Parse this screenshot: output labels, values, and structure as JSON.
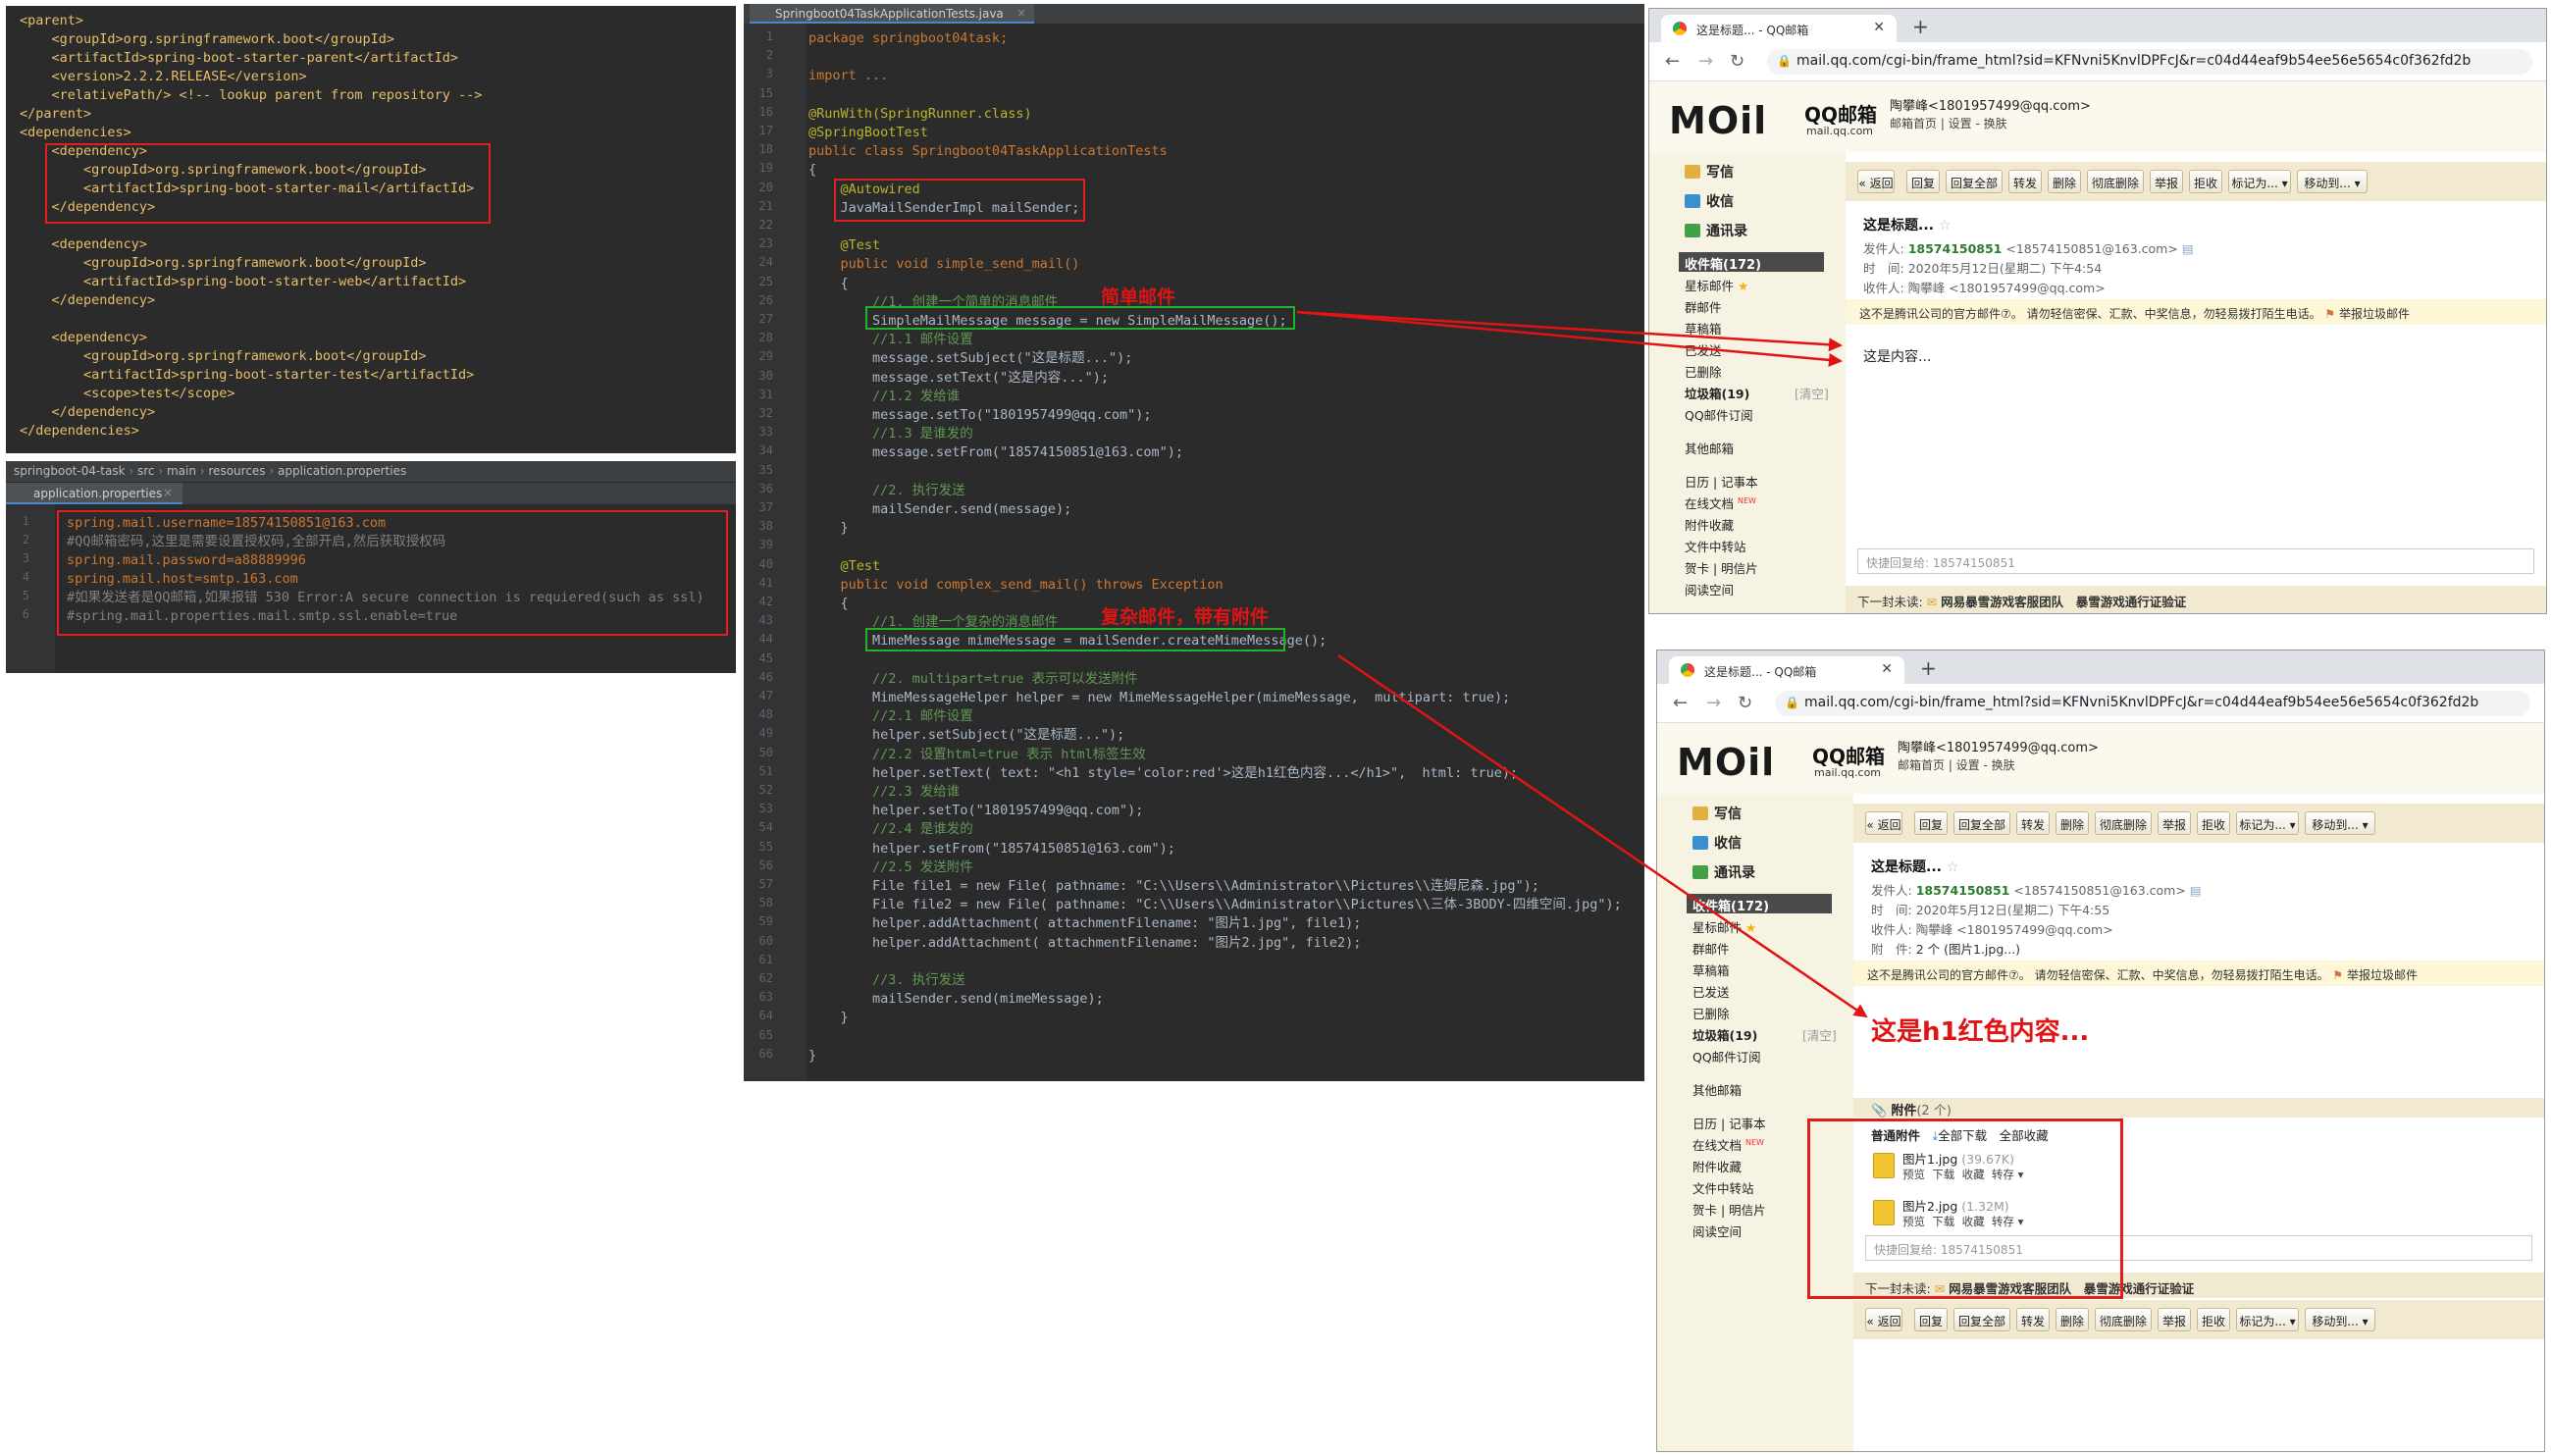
{
  "pom": {
    "lines": [
      "<parent>",
      "    <groupId>org.springframework.boot</groupId>",
      "    <artifactId>spring-boot-starter-parent</artifactId>",
      "    <version>2.2.2.RELEASE</version>",
      "    <relativePath/> <!-- lookup parent from repository -->",
      "</parent>",
      "<dependencies>",
      "    <dependency>",
      "        <groupId>org.springframework.boot</groupId>",
      "        <artifactId>spring-boot-starter-mail</artifactId>",
      "    </dependency>",
      "",
      "    <dependency>",
      "        <groupId>org.springframework.boot</groupId>",
      "        <artifactId>spring-boot-starter-web</artifactId>",
      "    </dependency>",
      "",
      "    <dependency>",
      "        <groupId>org.springframework.boot</groupId>",
      "        <artifactId>spring-boot-starter-test</artifactId>",
      "        <scope>test</scope>",
      "    </dependency>",
      "</dependencies>"
    ]
  },
  "props": {
    "breadcrumb": [
      "springboot-04-task",
      "src",
      "main",
      "resources",
      "application.properties"
    ],
    "tab": "application.properties",
    "line_numbers": [
      "1",
      "2",
      "3",
      "4",
      "5",
      "6"
    ],
    "lines": [
      "spring.mail.username=18574150851@163.com",
      "#QQ邮箱密码,这里是需要设置授权码,全部开启,然后获取授权码",
      "spring.mail.password=a88889996",
      "spring.mail.host=smtp.163.com",
      "#如果发送者是QQ邮箱,如果报错 530 Error:A secure connection is requiered(such as ssl)",
      "#spring.mail.properties.mail.smtp.ssl.enable=true"
    ]
  },
  "editor": {
    "tab": "Springboot04TaskApplicationTests.java",
    "line_numbers": [
      "1",
      "2",
      "3",
      "15",
      "16",
      "17",
      "18",
      "19",
      "20",
      "21",
      "22",
      "23",
      "24",
      "25",
      "26",
      "27",
      "28",
      "29",
      "30",
      "31",
      "32",
      "33",
      "34",
      "35",
      "36",
      "37",
      "38",
      "39",
      "40",
      "41",
      "42",
      "43",
      "44",
      "45",
      "46",
      "47",
      "48",
      "49",
      "50",
      "51",
      "52",
      "53",
      "54",
      "55",
      "56",
      "57",
      "58",
      "59",
      "60",
      "61",
      "62",
      "63",
      "64",
      "65",
      "66"
    ],
    "lines": [
      "package springboot04task;",
      "",
      "import ...",
      "",
      "@RunWith(SpringRunner.class)",
      "@SpringBootTest",
      "public class Springboot04TaskApplicationTests",
      "{",
      "    @Autowired",
      "    JavaMailSenderImpl mailSender;",
      "",
      "    @Test",
      "    public void simple_send_mail()",
      "    {",
      "        //1. 创建一个简单的消息邮件",
      "        SimpleMailMessage message = new SimpleMailMessage();",
      "        //1.1 邮件设置",
      "        message.setSubject(\"这是标题...\");",
      "        message.setText(\"这是内容...\");",
      "        //1.2 发给谁",
      "        message.setTo(\"1801957499@qq.com\");",
      "        //1.3 是谁发的",
      "        message.setFrom(\"18574150851@163.com\");",
      "",
      "        //2. 执行发送",
      "        mailSender.send(message);",
      "    }",
      "",
      "    @Test",
      "    public void complex_send_mail() throws Exception",
      "    {",
      "        //1. 创建一个复杂的消息邮件",
      "        MimeMessage mimeMessage = mailSender.createMimeMessage();",
      "",
      "        //2. multipart=true 表示可以发送附件",
      "        MimeMessageHelper helper = new MimeMessageHelper(mimeMessage,  multipart: true);",
      "        //2.1 邮件设置",
      "        helper.setSubject(\"这是标题...\");",
      "        //2.2 设置html=true 表示 html标签生效",
      "        helper.setText( text: \"<h1 style='color:red'>这是h1红色内容...</h1>\",  html: true);",
      "        //2.3 发给谁",
      "        helper.setTo(\"1801957499@qq.com\");",
      "        //2.4 是谁发的",
      "        helper.setFrom(\"18574150851@163.com\");",
      "        //2.5 发送附件",
      "        File file1 = new File( pathname: \"C:\\\\Users\\\\Administrator\\\\Pictures\\\\连姆尼森.jpg\");",
      "        File file2 = new File( pathname: \"C:\\\\Users\\\\Administrator\\\\Pictures\\\\三体-3BODY-四维空间.jpg\");",
      "        helper.addAttachment( attachmentFilename: \"图片1.jpg\", file1);",
      "        helper.addAttachment( attachmentFilename: \"图片2.jpg\", file2);",
      "",
      "        //3. 执行发送",
      "        mailSender.send(mimeMessage);",
      "    }",
      "",
      "}"
    ]
  },
  "annotations": {
    "simple": "简单邮件",
    "complex": "复杂邮件，带有附件"
  },
  "browser1": {
    "tab_title": "这是标题... - QQ邮箱",
    "url": "mail.qq.com/cgi-bin/frame_html?sid=KFNvni5KnvlDPFcJ&r=c04d44eaf9b54ee56e5654c0f362fd2b",
    "logo": "MOil",
    "logo_cn": "QQ邮箱",
    "logo_sub": "mail.qq.com",
    "user_email": "陶攀峰<1801957499@qq.com>",
    "user_links": "邮箱首页 | 设置 - 换肤",
    "side": {
      "compose": "写信",
      "inbox": "收信",
      "contacts": "通讯录",
      "inbox_count": "收件箱(172)",
      "starred": "星标邮件",
      "group": "群邮件",
      "drafts": "草稿箱",
      "sent": "已发送",
      "deleted": "已删除",
      "spam": "垃圾箱(19)",
      "clear": "[清空]",
      "subscribe": "QQ邮件订阅",
      "other": "其他邮箱",
      "calendar": "日历 | 记事本",
      "docs": "在线文档",
      "new_badge": "NEW",
      "attach_fav": "附件收藏",
      "transfer": "文件中转站",
      "cards": "贺卡 | 明信片",
      "reading": "阅读空间"
    },
    "toolbar": [
      "« 返回",
      "回复",
      "回复全部",
      "转发",
      "删除",
      "彻底删除",
      "举报",
      "拒收",
      "标记为... ▾",
      "移动到... ▾"
    ],
    "subject": "这是标题...",
    "from_label": "发件人:",
    "from_name": "18574150851",
    "from_addr": "<18574150851@163.com>",
    "time_label": "时　间:",
    "time": "2020年5月12日(星期二) 下午4:54",
    "to_label": "收件人:",
    "to": "陶攀峰 <1801957499@qq.com>",
    "warning": "这不是腾讯公司的官方邮件⑦。  请勿轻信密保、汇款、中奖信息，勿轻易拨打陌生电话。",
    "report": "举报垃圾邮件",
    "body": "这是内容...",
    "quick_reply": "快捷回复给: 18574150851",
    "next_label": "下一封未读:",
    "next_1": "网易暴雪游戏客服团队",
    "next_2": "暴雪游戏通行证验证"
  },
  "browser2": {
    "tab_title": "这是标题... - QQ邮箱",
    "url": "mail.qq.com/cgi-bin/frame_html?sid=KFNvni5KnvlDPFcJ&r=c04d44eaf9b54ee56e5654c0f362fd2b",
    "logo": "MOil",
    "logo_cn": "QQ邮箱",
    "logo_sub": "mail.qq.com",
    "user_email": "陶攀峰<1801957499@qq.com>",
    "user_links": "邮箱首页 | 设置 - 换肤",
    "side": {
      "compose": "写信",
      "inbox": "收信",
      "contacts": "通讯录",
      "inbox_count": "收件箱(172)",
      "starred": "星标邮件",
      "group": "群邮件",
      "drafts": "草稿箱",
      "sent": "已发送",
      "deleted": "已删除",
      "spam": "垃圾箱(19)",
      "clear": "[清空]",
      "subscribe": "QQ邮件订阅",
      "other": "其他邮箱",
      "calendar": "日历 | 记事本",
      "docs": "在线文档",
      "new_badge": "NEW",
      "attach_fav": "附件收藏",
      "transfer": "文件中转站",
      "cards": "贺卡 | 明信片",
      "reading": "阅读空间"
    },
    "toolbar": [
      "« 返回",
      "回复",
      "回复全部",
      "转发",
      "删除",
      "彻底删除",
      "举报",
      "拒收",
      "标记为... ▾",
      "移动到... ▾"
    ],
    "subject": "这是标题...",
    "from_label": "发件人:",
    "from_name": "18574150851",
    "from_addr": "<18574150851@163.com>",
    "time_label": "时　间:",
    "time": "2020年5月12日(星期二) 下午4:55",
    "to_label": "收件人:",
    "to": "陶攀峰 <1801957499@qq.com>",
    "attach_label": "附　件:",
    "attach_summary": "2 个 (图片1.jpg...)",
    "warning": "这不是腾讯公司的官方邮件⑦。  请勿轻信密保、汇款、中奖信息，勿轻易拨打陌生电话。",
    "report": "举报垃圾邮件",
    "body_h1": "这是h1红色内容...",
    "attach_title": "附件",
    "attach_count": "(2 个)",
    "attach_normal": "普通附件",
    "download_all": "全部下载",
    "save_all": "全部收藏",
    "files": [
      {
        "name": "图片1.jpg",
        "size": "(39.67K)",
        "actions": "预览  下载  收藏  转存 ▾"
      },
      {
        "name": "图片2.jpg",
        "size": "(1.32M)",
        "actions": "预览  下载  收藏  转存 ▾"
      }
    ],
    "quick_reply": "快捷回复给: 18574150851",
    "next_label": "下一封未读:",
    "next_1": "网易暴雪游戏客服团队",
    "next_2": "暴雪游戏通行证验证"
  },
  "colors": {
    "ide_bg": "#2b2b2b",
    "red_box": "#e02020",
    "green_box": "#1db52a",
    "h1_red": "#e01414"
  }
}
